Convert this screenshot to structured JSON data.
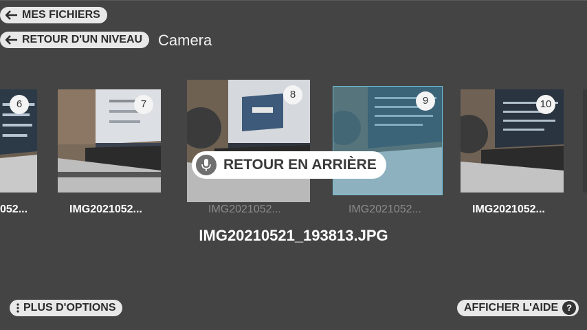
{
  "nav": {
    "my_files_label": "MES FICHIERS",
    "up_one_level_label": "RETOUR D'UN NIVEAU",
    "folder_name": "Camera"
  },
  "gallery": {
    "items": [
      {
        "number": "6",
        "filename": "052..."
      },
      {
        "number": "7",
        "filename": "IMG2021052..."
      },
      {
        "number": "8",
        "filename": "IMG2021052..."
      },
      {
        "number": "9",
        "filename": "IMG2021052..."
      },
      {
        "number": "10",
        "filename": "IMG2021052..."
      }
    ],
    "current_filename": "IMG20210521_193813.JPG"
  },
  "voice": {
    "back_label": "RETOUR EN ARRIÈRE",
    "mic_icon": "microphone-icon"
  },
  "footer": {
    "more_options_label": "PLUS D'OPTIONS",
    "show_help_label": "AFFICHER L'AIDE",
    "help_icon_glyph": "?"
  },
  "colors": {
    "background": "#444444",
    "selection": "#6fc0d8",
    "pill": "#e8e8e8"
  }
}
